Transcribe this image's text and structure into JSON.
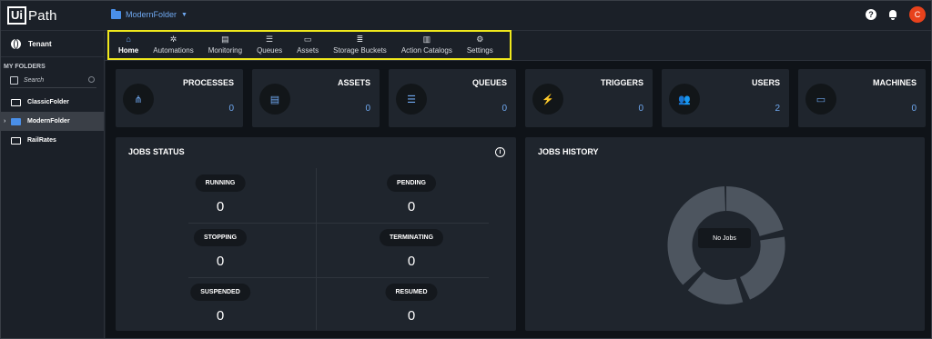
{
  "app": {
    "logo_box": "Ui",
    "logo_text": "Path",
    "current_folder": "ModernFolder",
    "avatar_initial": "C",
    "help_glyph": "?"
  },
  "sidebar": {
    "tenant_label": "Tenant",
    "section_label": "MY FOLDERS",
    "search_placeholder": "Search",
    "folders": [
      {
        "label": "ClassicFolder",
        "active": false
      },
      {
        "label": "ModernFolder",
        "active": true
      },
      {
        "label": "RailRates",
        "active": false
      }
    ]
  },
  "nav": {
    "tabs": [
      {
        "label": "Home",
        "icon": "home-icon",
        "active": true
      },
      {
        "label": "Automations",
        "icon": "automations-icon",
        "active": false
      },
      {
        "label": "Monitoring",
        "icon": "monitoring-icon",
        "active": false
      },
      {
        "label": "Queues",
        "icon": "queues-icon",
        "active": false
      },
      {
        "label": "Assets",
        "icon": "assets-icon",
        "active": false
      },
      {
        "label": "Storage Buckets",
        "icon": "storage-buckets-icon",
        "active": false
      },
      {
        "label": "Action Catalogs",
        "icon": "action-catalogs-icon",
        "active": false
      },
      {
        "label": "Settings",
        "icon": "settings-icon",
        "active": false
      }
    ],
    "highlight_color": "#f0e81c"
  },
  "summary": [
    {
      "title": "PROCESSES",
      "value": "0",
      "icon": "processes-icon"
    },
    {
      "title": "ASSETS",
      "value": "0",
      "icon": "assets-icon"
    },
    {
      "title": "QUEUES",
      "value": "0",
      "icon": "queues-icon"
    },
    {
      "title": "TRIGGERS",
      "value": "0",
      "icon": "triggers-icon"
    },
    {
      "title": "USERS",
      "value": "2",
      "icon": "users-icon"
    },
    {
      "title": "MACHINES",
      "value": "0",
      "icon": "machines-icon"
    }
  ],
  "jobs_status": {
    "title": "JOBS STATUS",
    "info_glyph": "i",
    "states": [
      {
        "label": "RUNNING",
        "count": "0"
      },
      {
        "label": "PENDING",
        "count": "0"
      },
      {
        "label": "STOPPING",
        "count": "0"
      },
      {
        "label": "TERMINATING",
        "count": "0"
      },
      {
        "label": "SUSPENDED",
        "count": "0"
      },
      {
        "label": "RESUMED",
        "count": "0"
      }
    ]
  },
  "jobs_history": {
    "title": "JOBS HISTORY",
    "empty_label": "No Jobs"
  },
  "colors": {
    "accent": "#6fa8f0",
    "avatar": "#e8421c",
    "donut": "#4d555f"
  }
}
